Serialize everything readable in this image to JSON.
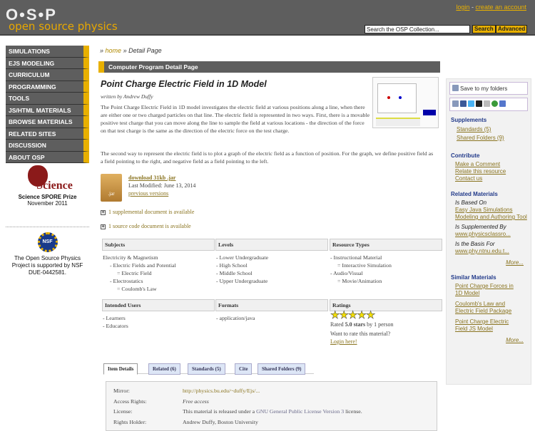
{
  "header": {
    "logo": "O•S•P",
    "logo_sub": "open source physics",
    "login": "login",
    "sep": " - ",
    "create_account": "create an account",
    "search_placeholder": "Search the OSP Collection...",
    "search_btn": "Search",
    "advanced_btn": "Advanced"
  },
  "nav": [
    "SIMULATIONS",
    "EJS MODELING",
    "CURRICULUM",
    "PROGRAMMING",
    "TOOLS",
    "JS/HTML MATERIALS",
    "BROWSE MATERIALS",
    "RELATED SITES",
    "DISCUSSION",
    "ABOUT OSP"
  ],
  "awards": {
    "science_logo": "Science",
    "prize": "Science SPORE Prize",
    "prize_date": "November 2011",
    "nsf_logo": "NSF",
    "nsf_text": "The Open Source Physics Project is supported by NSF DUE-0442581."
  },
  "breadcrumb": {
    "sep": "»",
    "home": "home",
    "current": "Detail Page"
  },
  "section_bar": "Computer Program Detail Page",
  "title": "Point Charge Electric Field in 1D Model",
  "author": "written by Andrew Duffy",
  "desc1": "The Point Charge Electric Field in 1D model investigates the electric field at various positions along a line, when there are either one or two charged particles on that line. The electric field is represented in two ways. First, there is a movable positive test charge that you can move along the line to sample the field at various locations - the direction of the force on that test charge is the same as the direction of the electric force on the test charge.",
  "desc2": "The second way to represent the electric field is to plot a graph of the electric field as a function of position. For the graph, we define positive field as a field pointing to the right, and negative field as a field pointing to the left.",
  "download": {
    "icon_label": ".jar",
    "link": "download 31kb .jar",
    "modified": "Last Modified: June 13, 2014",
    "previous": "previous versions"
  },
  "supplemental": "1 supplemental document is available",
  "source": "1 source code document is available",
  "subjects": {
    "header": "Subjects",
    "items": [
      "Electricity & Magnetism",
      "- Electric Fields and Potential",
      "= Electric Field",
      "- Electrostatics",
      "= Coulomb's Law"
    ]
  },
  "levels": {
    "header": "Levels",
    "items": [
      "- Lower Undergraduate",
      "- High School",
      "- Middle School",
      "- Upper Undergraduate"
    ]
  },
  "resource_types": {
    "header": "Resource Types",
    "items": [
      "- Instructional Material",
      "= Interactive Simulation",
      "- Audio/Visual",
      "= Movie/Animation"
    ]
  },
  "users": {
    "header": "Intended Users",
    "items": [
      "- Learners",
      "- Educators"
    ]
  },
  "formats": {
    "header": "Formats",
    "items": [
      "- application/java"
    ]
  },
  "ratings": {
    "header": "Ratings",
    "stars": 5,
    "rated_pre": "Rated ",
    "rated_val": "5.0 stars",
    "rated_post": " by 1 person",
    "want": "Want to rate this material?",
    "login": "Login here!"
  },
  "tabs": [
    "Item Details",
    "Related (6)",
    "Standards (5)",
    "Cite",
    "Shared Folders (9)"
  ],
  "details": [
    {
      "k": "Mirror:",
      "v": "http://physics.bu.edu/~duffy/Ejs/..."
    },
    {
      "k": "Access Rights:",
      "v": "Free access"
    },
    {
      "k": "License:",
      "pre": "This material is released under a ",
      "link": "GNU General Public License Version 3",
      "post": " license."
    },
    {
      "k": "Rights Holder:",
      "v": "Andrew Duffy, Boston University"
    }
  ],
  "right": {
    "save": "Save to my folders",
    "supplements": {
      "h": "Supplements",
      "items": [
        "Standards (5)",
        "Shared Folders (9)"
      ]
    },
    "contribute": {
      "h": "Contribute",
      "items": [
        "Make a Comment",
        "Relate this resource",
        "Contact us"
      ]
    },
    "related": {
      "h": "Related Materials",
      "groups": [
        {
          "label": "Is Based On",
          "link": "Easy Java Simulations Modeling and Authoring Tool"
        },
        {
          "label": "Is Supplemented By",
          "link": "www.physicsclassro..."
        },
        {
          "label": "Is the Basis For",
          "link": "www.phy.ntnu.edu.t..."
        }
      ],
      "more": "More..."
    },
    "similar": {
      "h": "Similar Materials",
      "items": [
        "Point Charge Forces in 1D Model",
        "Coulomb's Law and Electric Field Package",
        "Point Charge Electric Field JS Model"
      ],
      "more": "More..."
    }
  },
  "colors": {
    "header": "#5e5e5e",
    "accent": "#e8b000",
    "link": "#8a7420",
    "heading": "#223a8a"
  }
}
